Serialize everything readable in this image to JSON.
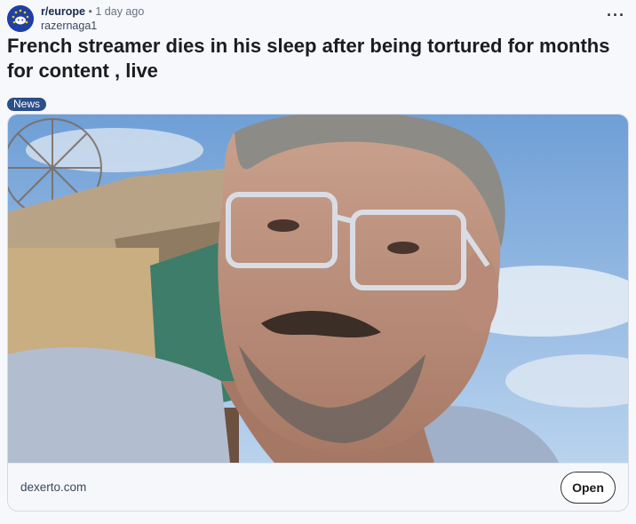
{
  "post": {
    "subreddit": "r/europe",
    "separator": "•",
    "time": "1 day ago",
    "author": "razernaga1",
    "more_icon": "ellipsis-icon",
    "title": "French streamer dies in his sleep after being tortured for months for content , live",
    "flair": "News",
    "flair_color": "#2c4e8a"
  },
  "link_card": {
    "image_icon": "photo-thumbnail",
    "domain": "dexerto.com",
    "open_label": "Open"
  }
}
